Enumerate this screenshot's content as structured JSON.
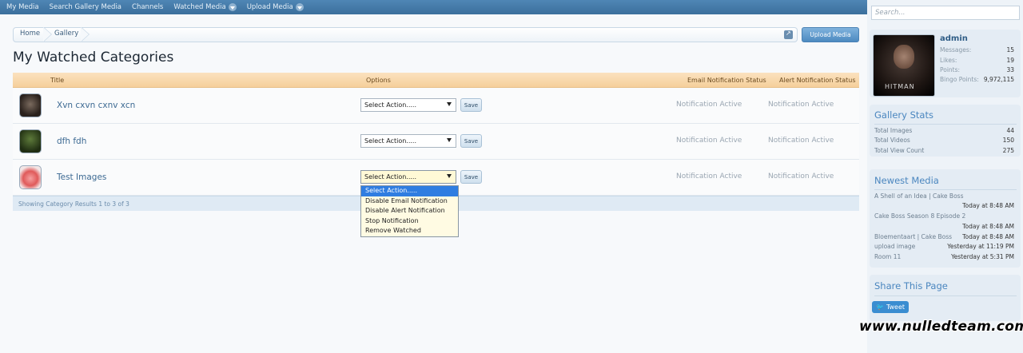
{
  "nav": {
    "items": [
      {
        "label": "My Media",
        "dropdown": false
      },
      {
        "label": "Search Gallery Media",
        "dropdown": false
      },
      {
        "label": "Channels",
        "dropdown": false
      },
      {
        "label": "Watched Media",
        "dropdown": true
      },
      {
        "label": "Upload Media",
        "dropdown": true
      }
    ]
  },
  "breadcrumb": {
    "home": "Home",
    "gallery": "Gallery"
  },
  "upload_button": "Upload Media",
  "page_title": "My Watched Categories",
  "table": {
    "headers": {
      "title": "Title",
      "options": "Options",
      "email_status": "Email Notification Status",
      "alert_status": "Alert Notification Status"
    },
    "rows": [
      {
        "name": "Xvn cxvn cxnv xcn",
        "select": "Select Action.....",
        "save": "Save",
        "email": "Notification Active",
        "alert": "Notification Active"
      },
      {
        "name": "dfh fdh",
        "select": "Select Action.....",
        "save": "Save",
        "email": "Notification Active",
        "alert": "Notification Active"
      },
      {
        "name": "Test Images",
        "select": "Select Action.....",
        "save": "Save",
        "email": "Notification Active",
        "alert": "Notification Active"
      }
    ],
    "results": "Showing Category Results 1 to 3 of 3"
  },
  "dropdown_options": [
    "Select Action.....",
    "Disable Email Notification",
    "Disable Alert Notification",
    "Stop Notification",
    "Remove Watched"
  ],
  "sidebar": {
    "search_placeholder": "Search...",
    "user": {
      "avatar_text": "HITMAN",
      "name": "admin",
      "stats": [
        {
          "label": "Messages:",
          "value": "15"
        },
        {
          "label": "Likes:",
          "value": "19"
        },
        {
          "label": "Points:",
          "value": "33"
        },
        {
          "label": "Bingo Points:",
          "value": "9,972,115"
        }
      ]
    },
    "gallery_stats": {
      "title": "Gallery Stats",
      "rows": [
        {
          "label": "Total Images",
          "value": "44"
        },
        {
          "label": "Total Videos",
          "value": "150"
        },
        {
          "label": "Total View Count",
          "value": "275"
        }
      ]
    },
    "newest_media": {
      "title": "Newest Media",
      "items": [
        {
          "title": "A Shell of an Idea | Cake Boss",
          "time": "Today at 8:48 AM"
        },
        {
          "title": "Cake Boss Season 8 Episode 2",
          "time": "Today at 8:48 AM"
        },
        {
          "title": "Bloementaart | Cake Boss",
          "time": "Today at 8:48 AM"
        },
        {
          "title": "upload image",
          "time": "Yesterday at 11:19 PM"
        },
        {
          "title": "Room 11",
          "time": "Yesterday at 5:31 PM"
        }
      ]
    },
    "share": {
      "title": "Share This Page",
      "tweet": "Tweet"
    }
  },
  "watermark": "www.nulledteam.com"
}
